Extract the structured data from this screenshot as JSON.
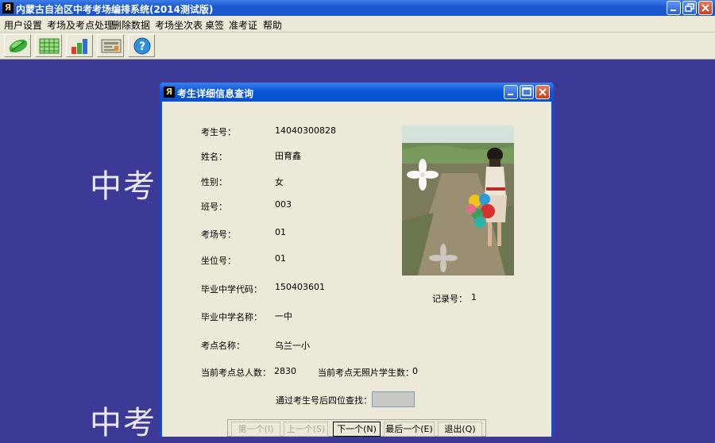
{
  "window": {
    "title": "内蒙古自治区中考考场编排系统(2014测试版)",
    "icon_glyph": "Я"
  },
  "menu": [
    {
      "label": "用户设置"
    },
    {
      "label": "考场及考点处理"
    },
    {
      "label": "删除数据"
    },
    {
      "label": "考场坐次表"
    },
    {
      "label": "桌签"
    },
    {
      "label": "准考证"
    },
    {
      "label": "帮助"
    }
  ],
  "toolbar": [
    {
      "icon": "leaf-icon"
    },
    {
      "icon": "spreadsheet-icon"
    },
    {
      "icon": "bar-chart-icon"
    },
    {
      "icon": "form-icon"
    },
    {
      "icon": "help-icon"
    }
  ],
  "background": {
    "text_1": "中考",
    "text_2": "中考"
  },
  "dialog": {
    "title": "考生详细信息查询",
    "fields": {
      "student_no": {
        "label": "考生号：",
        "value": "14040300828"
      },
      "name": {
        "label": "姓名：",
        "value": "田育鑫"
      },
      "gender": {
        "label": "性别：",
        "value": "女"
      },
      "class_no": {
        "label": "班号：",
        "value": "003"
      },
      "room_no": {
        "label": "考场号：",
        "value": "01"
      },
      "seat_no": {
        "label": "坐位号：",
        "value": "01"
      },
      "school_code": {
        "label": "毕业中学代码：",
        "value": "150403601"
      },
      "school_name": {
        "label": "毕业中学名称：",
        "value": "一中"
      },
      "site_name": {
        "label": "考点名称：",
        "value": "乌兰一小"
      },
      "site_total": {
        "label": "当前考点总人数：",
        "value": "2830"
      },
      "no_photo": {
        "label": "当前考点无照片学生数：",
        "value": "0"
      },
      "record_no": {
        "label": "记录号：",
        "value": "1"
      }
    },
    "search": {
      "label": "通过考生号后四位查找：",
      "value": ""
    },
    "buttons": {
      "first": "第一个(I)",
      "prev": "上一个(S)",
      "next": "下一个(N)",
      "last": "最后一个(E)",
      "exit": "退出(Q)"
    }
  },
  "colors": {
    "desktop": "#3d3996",
    "titlebar": "#0a57d8",
    "panel": "#ece9d8"
  }
}
